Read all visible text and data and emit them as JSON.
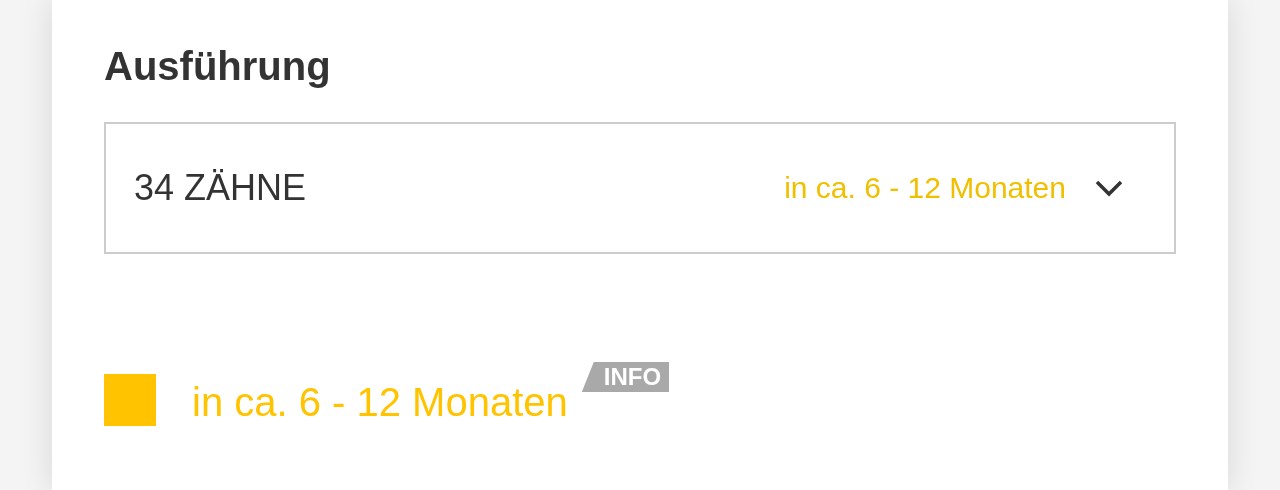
{
  "section_title": "Ausführung",
  "select": {
    "value": "34 ZÄHNE",
    "availability": "in ca. 6 - 12 Monaten"
  },
  "availability": {
    "color": "#ffc300",
    "text": "in ca. 6 - 12 Monaten",
    "badge": "INFO"
  }
}
